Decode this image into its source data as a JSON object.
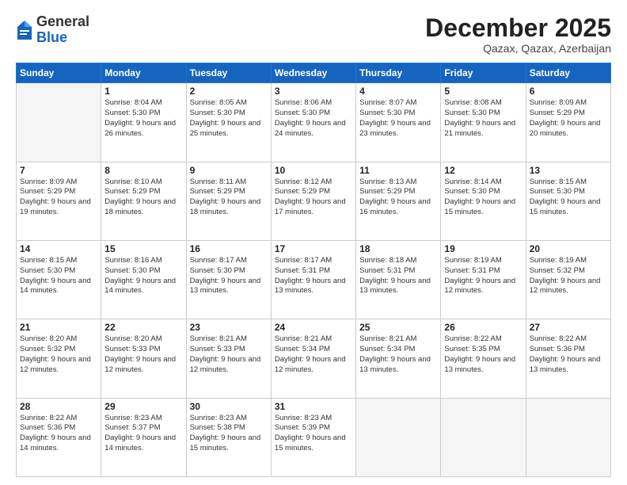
{
  "header": {
    "logo_general": "General",
    "logo_blue": "Blue",
    "month_title": "December 2025",
    "location": "Qazax, Qazax, Azerbaijan"
  },
  "days_of_week": [
    "Sunday",
    "Monday",
    "Tuesday",
    "Wednesday",
    "Thursday",
    "Friday",
    "Saturday"
  ],
  "weeks": [
    [
      {
        "day": "",
        "empty": true
      },
      {
        "day": "1",
        "sunrise": "Sunrise: 8:04 AM",
        "sunset": "Sunset: 5:30 PM",
        "daylight": "Daylight: 9 hours and 26 minutes."
      },
      {
        "day": "2",
        "sunrise": "Sunrise: 8:05 AM",
        "sunset": "Sunset: 5:30 PM",
        "daylight": "Daylight: 9 hours and 25 minutes."
      },
      {
        "day": "3",
        "sunrise": "Sunrise: 8:06 AM",
        "sunset": "Sunset: 5:30 PM",
        "daylight": "Daylight: 9 hours and 24 minutes."
      },
      {
        "day": "4",
        "sunrise": "Sunrise: 8:07 AM",
        "sunset": "Sunset: 5:30 PM",
        "daylight": "Daylight: 9 hours and 23 minutes."
      },
      {
        "day": "5",
        "sunrise": "Sunrise: 8:08 AM",
        "sunset": "Sunset: 5:30 PM",
        "daylight": "Daylight: 9 hours and 21 minutes."
      },
      {
        "day": "6",
        "sunrise": "Sunrise: 8:09 AM",
        "sunset": "Sunset: 5:29 PM",
        "daylight": "Daylight: 9 hours and 20 minutes."
      }
    ],
    [
      {
        "day": "7",
        "sunrise": "Sunrise: 8:09 AM",
        "sunset": "Sunset: 5:29 PM",
        "daylight": "Daylight: 9 hours and 19 minutes."
      },
      {
        "day": "8",
        "sunrise": "Sunrise: 8:10 AM",
        "sunset": "Sunset: 5:29 PM",
        "daylight": "Daylight: 9 hours and 18 minutes."
      },
      {
        "day": "9",
        "sunrise": "Sunrise: 8:11 AM",
        "sunset": "Sunset: 5:29 PM",
        "daylight": "Daylight: 9 hours and 18 minutes."
      },
      {
        "day": "10",
        "sunrise": "Sunrise: 8:12 AM",
        "sunset": "Sunset: 5:29 PM",
        "daylight": "Daylight: 9 hours and 17 minutes."
      },
      {
        "day": "11",
        "sunrise": "Sunrise: 8:13 AM",
        "sunset": "Sunset: 5:29 PM",
        "daylight": "Daylight: 9 hours and 16 minutes."
      },
      {
        "day": "12",
        "sunrise": "Sunrise: 8:14 AM",
        "sunset": "Sunset: 5:30 PM",
        "daylight": "Daylight: 9 hours and 15 minutes."
      },
      {
        "day": "13",
        "sunrise": "Sunrise: 8:15 AM",
        "sunset": "Sunset: 5:30 PM",
        "daylight": "Daylight: 9 hours and 15 minutes."
      }
    ],
    [
      {
        "day": "14",
        "sunrise": "Sunrise: 8:15 AM",
        "sunset": "Sunset: 5:30 PM",
        "daylight": "Daylight: 9 hours and 14 minutes."
      },
      {
        "day": "15",
        "sunrise": "Sunrise: 8:16 AM",
        "sunset": "Sunset: 5:30 PM",
        "daylight": "Daylight: 9 hours and 14 minutes."
      },
      {
        "day": "16",
        "sunrise": "Sunrise: 8:17 AM",
        "sunset": "Sunset: 5:30 PM",
        "daylight": "Daylight: 9 hours and 13 minutes."
      },
      {
        "day": "17",
        "sunrise": "Sunrise: 8:17 AM",
        "sunset": "Sunset: 5:31 PM",
        "daylight": "Daylight: 9 hours and 13 minutes."
      },
      {
        "day": "18",
        "sunrise": "Sunrise: 8:18 AM",
        "sunset": "Sunset: 5:31 PM",
        "daylight": "Daylight: 9 hours and 13 minutes."
      },
      {
        "day": "19",
        "sunrise": "Sunrise: 8:19 AM",
        "sunset": "Sunset: 5:31 PM",
        "daylight": "Daylight: 9 hours and 12 minutes."
      },
      {
        "day": "20",
        "sunrise": "Sunrise: 8:19 AM",
        "sunset": "Sunset: 5:32 PM",
        "daylight": "Daylight: 9 hours and 12 minutes."
      }
    ],
    [
      {
        "day": "21",
        "sunrise": "Sunrise: 8:20 AM",
        "sunset": "Sunset: 5:32 PM",
        "daylight": "Daylight: 9 hours and 12 minutes."
      },
      {
        "day": "22",
        "sunrise": "Sunrise: 8:20 AM",
        "sunset": "Sunset: 5:33 PM",
        "daylight": "Daylight: 9 hours and 12 minutes."
      },
      {
        "day": "23",
        "sunrise": "Sunrise: 8:21 AM",
        "sunset": "Sunset: 5:33 PM",
        "daylight": "Daylight: 9 hours and 12 minutes."
      },
      {
        "day": "24",
        "sunrise": "Sunrise: 8:21 AM",
        "sunset": "Sunset: 5:34 PM",
        "daylight": "Daylight: 9 hours and 12 minutes."
      },
      {
        "day": "25",
        "sunrise": "Sunrise: 8:21 AM",
        "sunset": "Sunset: 5:34 PM",
        "daylight": "Daylight: 9 hours and 13 minutes."
      },
      {
        "day": "26",
        "sunrise": "Sunrise: 8:22 AM",
        "sunset": "Sunset: 5:35 PM",
        "daylight": "Daylight: 9 hours and 13 minutes."
      },
      {
        "day": "27",
        "sunrise": "Sunrise: 8:22 AM",
        "sunset": "Sunset: 5:36 PM",
        "daylight": "Daylight: 9 hours and 13 minutes."
      }
    ],
    [
      {
        "day": "28",
        "sunrise": "Sunrise: 8:22 AM",
        "sunset": "Sunset: 5:36 PM",
        "daylight": "Daylight: 9 hours and 14 minutes."
      },
      {
        "day": "29",
        "sunrise": "Sunrise: 8:23 AM",
        "sunset": "Sunset: 5:37 PM",
        "daylight": "Daylight: 9 hours and 14 minutes."
      },
      {
        "day": "30",
        "sunrise": "Sunrise: 8:23 AM",
        "sunset": "Sunset: 5:38 PM",
        "daylight": "Daylight: 9 hours and 15 minutes."
      },
      {
        "day": "31",
        "sunrise": "Sunrise: 8:23 AM",
        "sunset": "Sunset: 5:39 PM",
        "daylight": "Daylight: 9 hours and 15 minutes."
      },
      {
        "day": "",
        "empty": true
      },
      {
        "day": "",
        "empty": true
      },
      {
        "day": "",
        "empty": true
      }
    ]
  ]
}
